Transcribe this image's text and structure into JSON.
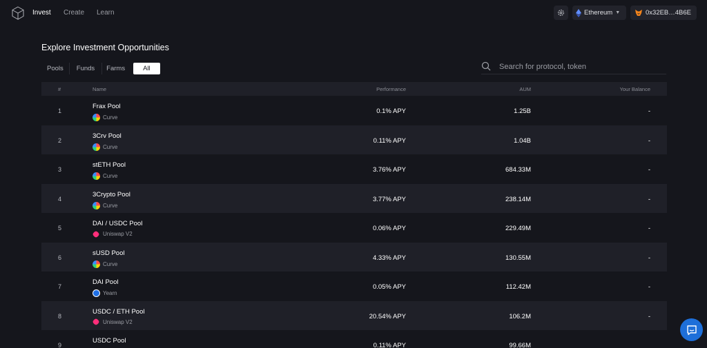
{
  "nav": {
    "links": [
      "Invest",
      "Create",
      "Learn"
    ]
  },
  "network": {
    "label": "Ethereum"
  },
  "wallet": {
    "address": "0x32EB…4B6E"
  },
  "page": {
    "title": "Explore Investment Opportunities",
    "tabs": [
      "Pools",
      "Funds",
      "Farms",
      "All"
    ],
    "active_tab": "All",
    "search_placeholder": "Search for protocol, token"
  },
  "table": {
    "headers": [
      "#",
      "Name",
      "Performance",
      "AUM",
      "Your Balance"
    ],
    "rows": [
      {
        "num": "1",
        "name": "Frax Pool",
        "protocol": "Curve",
        "icon": "curve-icon",
        "performance": "0.1% APY",
        "aum": "1.25B",
        "balance": "-"
      },
      {
        "num": "2",
        "name": "3Crv Pool",
        "protocol": "Curve",
        "icon": "curve-icon",
        "performance": "0.11% APY",
        "aum": "1.04B",
        "balance": "-"
      },
      {
        "num": "3",
        "name": "stETH Pool",
        "protocol": "Curve",
        "icon": "curve-icon",
        "performance": "3.76% APY",
        "aum": "684.33M",
        "balance": "-"
      },
      {
        "num": "4",
        "name": "3Crypto Pool",
        "protocol": "Curve",
        "icon": "curve-icon",
        "performance": "3.77% APY",
        "aum": "238.14M",
        "balance": "-"
      },
      {
        "num": "5",
        "name": "DAI / USDC Pool",
        "protocol": "Uniswap V2",
        "icon": "uniswap-icon",
        "performance": "0.06% APY",
        "aum": "229.49M",
        "balance": "-"
      },
      {
        "num": "6",
        "name": "sUSD Pool",
        "protocol": "Curve",
        "icon": "curve-icon",
        "performance": "4.33% APY",
        "aum": "130.55M",
        "balance": "-"
      },
      {
        "num": "7",
        "name": "DAI Pool",
        "protocol": "Yearn",
        "icon": "yearn-icon",
        "performance": "0.05% APY",
        "aum": "112.42M",
        "balance": "-"
      },
      {
        "num": "8",
        "name": "USDC / ETH Pool",
        "protocol": "Uniswap V2",
        "icon": "uniswap-icon",
        "performance": "20.54% APY",
        "aum": "106.2M",
        "balance": "-"
      },
      {
        "num": "9",
        "name": "USDC Pool",
        "protocol": "",
        "icon": "yearn-icon",
        "performance": "0.11% APY",
        "aum": "99.66M",
        "balance": ""
      }
    ]
  },
  "colors": {
    "background": "#15161c",
    "row_alt": "#1f2028",
    "accent": "#1e6fd9"
  }
}
